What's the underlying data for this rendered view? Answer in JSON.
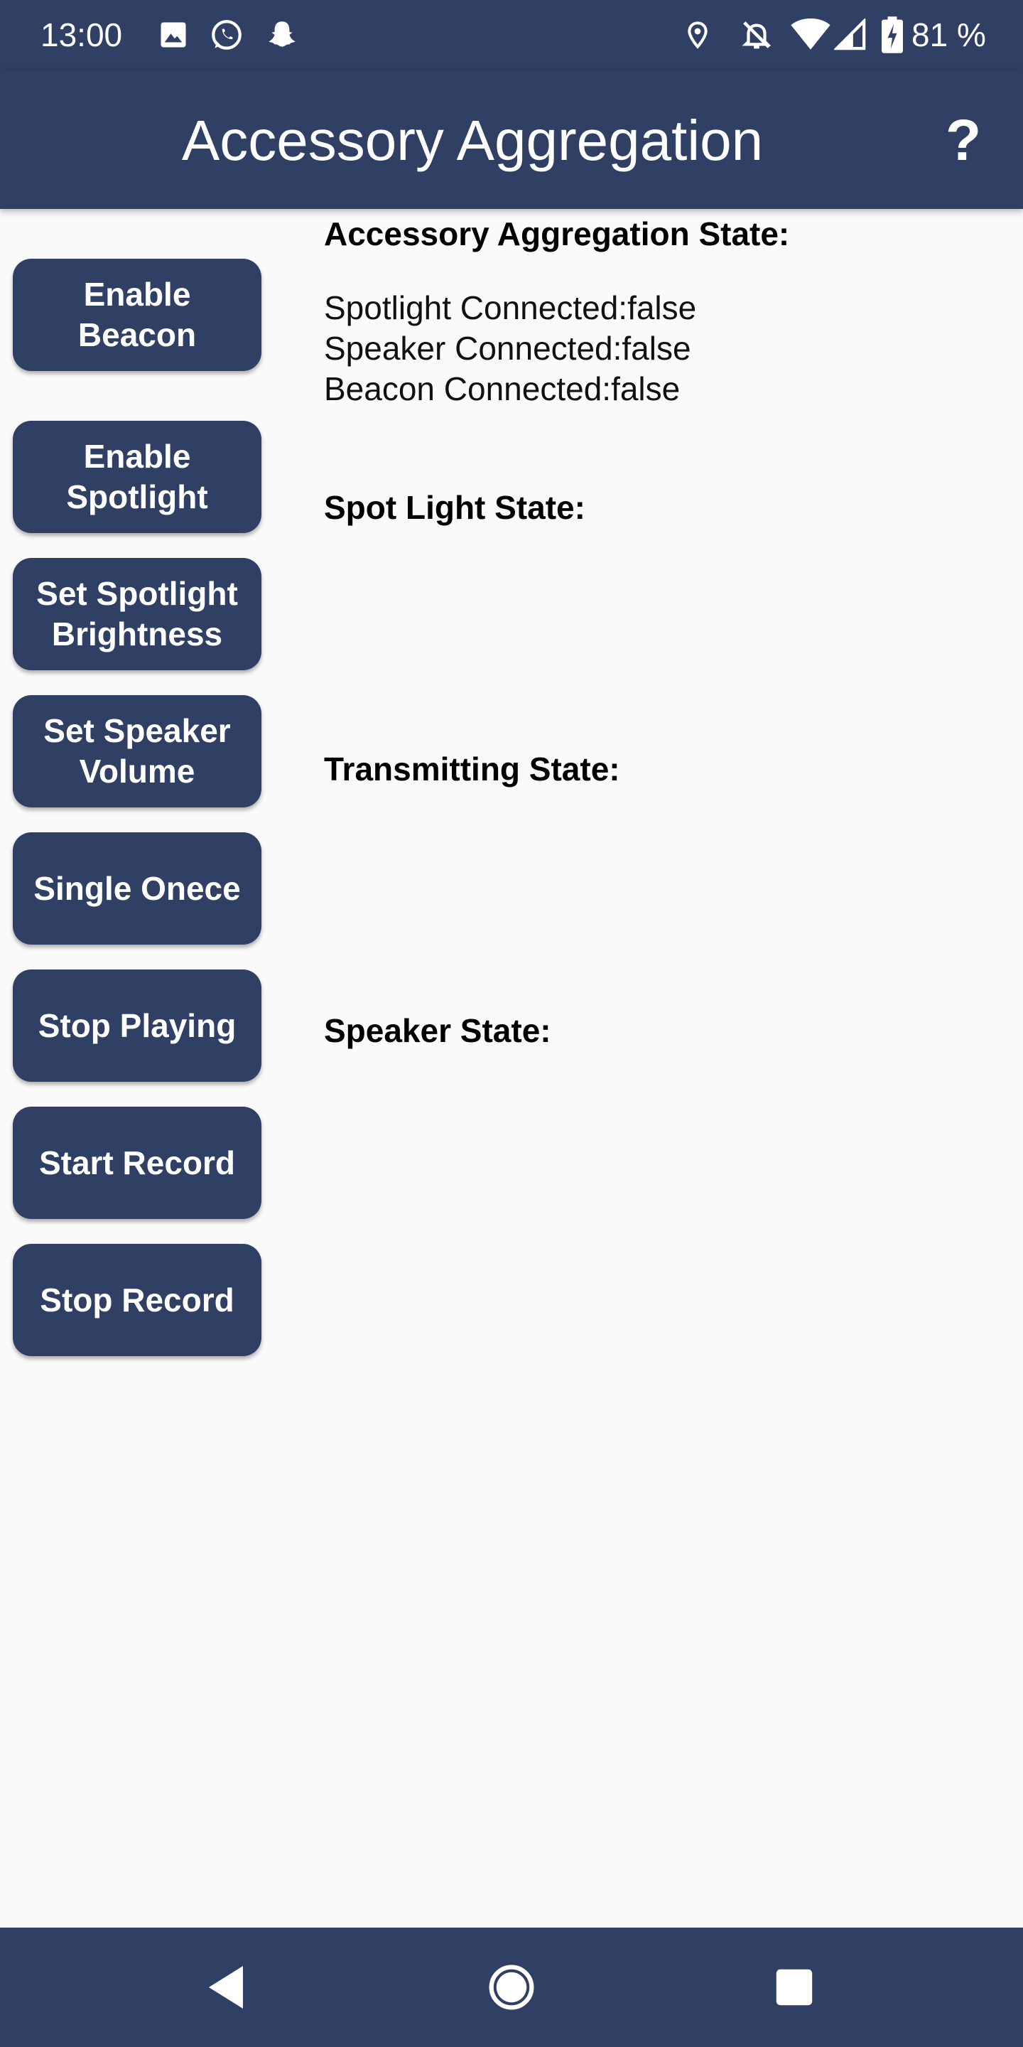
{
  "status_bar": {
    "time": "13:00",
    "battery_percent": "81 %",
    "icons": [
      "image-icon",
      "whatsapp-icon",
      "snapchat-icon",
      "location-icon",
      "bell-off-icon",
      "wifi-icon",
      "cell-signal-icon",
      "battery-charging-icon"
    ]
  },
  "app_bar": {
    "title": "Accessory Aggregation",
    "help_label": "?"
  },
  "buttons": {
    "enable_beacon": "Enable Beacon",
    "enable_spotlight": "Enable Spotlight",
    "set_spotlight_brightness": "Set Spotlight Brightness",
    "set_speaker_volume": "Set Speaker Volume",
    "single_once": "Single Onece",
    "stop_playing": "Stop Playing",
    "start_record": "Start Record",
    "stop_record": "Stop Record"
  },
  "states": {
    "aggregation_heading": "Accessory Aggregation State:",
    "spotlight_connected": "Spotlight Connected:false",
    "speaker_connected": "Speaker Connected:false",
    "beacon_connected": "Beacon Connected:false",
    "spotlight_heading": "Spot Light State:",
    "transmitting_heading": "Transmitting State:",
    "speaker_heading": "Speaker State:"
  },
  "colors": {
    "primary": "#303f64",
    "background": "#fafafa"
  },
  "nav_bar": {
    "icons": [
      "back-icon",
      "home-icon",
      "recents-icon"
    ]
  }
}
